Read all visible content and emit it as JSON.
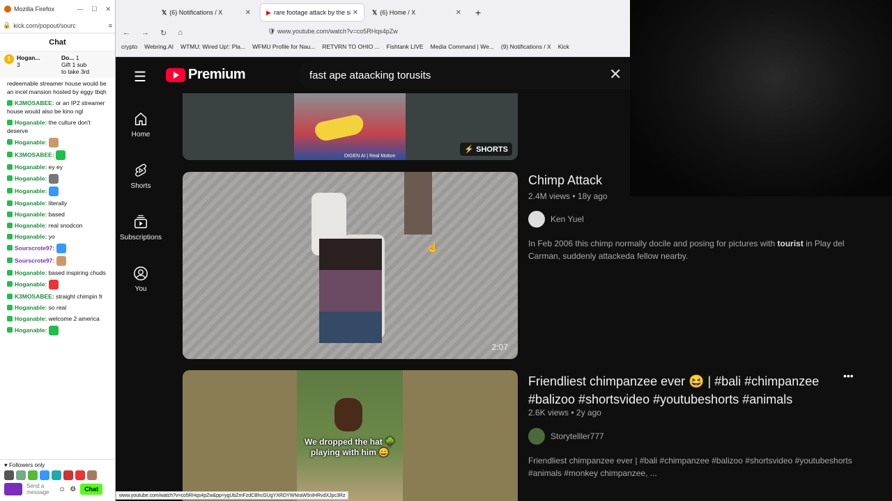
{
  "chat_popout": {
    "window_title": "Mozilla Firefox",
    "url": "kick.com/popout/sourc",
    "header": "Chat",
    "pinned": [
      {
        "badge": "1",
        "name": "Hogan...",
        "count": "3"
      },
      {
        "name": "Do...",
        "count": "1",
        "line1": "Gift 1 sub",
        "line2": "to take 3rd"
      }
    ],
    "messages": [
      {
        "user": "",
        "text": "redeemable streamer house would be an incel mansion hosted by eggy tbqh"
      },
      {
        "user": "K3MOSABEE:",
        "text": "or an IP2 streamer house would also be kino ngl"
      },
      {
        "user": "Hoganable:",
        "text": "the culture don't deserve"
      },
      {
        "user": "Hoganable:",
        "text": ""
      },
      {
        "user": "K3MOSABEE:",
        "text": ""
      },
      {
        "user": "Hoganable:",
        "text": "ey ey"
      },
      {
        "user": "Hoganable:",
        "text": ""
      },
      {
        "user": "Hoganable:",
        "text": ""
      },
      {
        "user": "Hoganable:",
        "text": "literally"
      },
      {
        "user": "Hoganable:",
        "text": "based"
      },
      {
        "user": "Hoganable:",
        "text": "real snodcon"
      },
      {
        "user": "Hoganable:",
        "text": "yo"
      },
      {
        "user": "Sourscrote97:",
        "text": ""
      },
      {
        "user": "Sourscrote97:",
        "text": ""
      },
      {
        "user": "Hoganable:",
        "text": "based inspiring chuds"
      },
      {
        "user": "Hoganable:",
        "text": ""
      },
      {
        "user": "K3MOSABEE:",
        "text": "straight chimpin fr"
      },
      {
        "user": "Hoganable:",
        "text": "so real"
      },
      {
        "user": "Hoganable:",
        "text": "welcome 2 america"
      },
      {
        "user": "Hoganable:",
        "text": ""
      }
    ],
    "followers_only": "Followers only",
    "send_placeholder": "Send a message",
    "chat_button": "Chat"
  },
  "browser": {
    "tabs": [
      "(6) Notifications / X",
      "rare footage attack by the silve",
      "(6) Home / X"
    ],
    "url": "www.youtube.com/watch?v=co5RHqs4pZw",
    "bookmarks": [
      "crypto",
      "Webring.AI",
      "WTMU: Wired Up!: Pla...",
      "WFMU Profile for Nau...",
      "RETVRN TO OHIO ...",
      "Fishtank LIVE",
      "Media Command | We...",
      "(9) Notifications / X",
      "Kick"
    ]
  },
  "youtube": {
    "logo": "Premium",
    "search_value": "fast ape ataacking torusits",
    "sidebar": [
      "Home",
      "Shorts",
      "Subscriptions",
      "You"
    ],
    "shorts_badge": "SHORTS",
    "results": [
      {
        "title": "Chimp Attack",
        "views": "2.4M",
        "age": "18y ago",
        "channel": "Ken Yuel",
        "duration": "2:07",
        "description_pre": "In Feb 2006 this chimp normally docile and posing for pictures with ",
        "description_bold": "tourist",
        "description_post": " in Play del Carman, suddenly attackeda fellow nearby."
      },
      {
        "title": "Friendliest chimpanzee ever 😆 | #bali #chimpanzee #balizoo #shortsvideo #youtubeshorts #animals",
        "views": "2.6K",
        "age": "2y ago",
        "channel": "Storytelller777",
        "caption": "We dropped the hat 🌳 playing with him 😄",
        "description": "Friendliest chimpanzee ever | #bali #chimpanzee #balizoo #shortsvideo #youtubeshorts #animals #monkey chimpanzee, ..."
      }
    ],
    "thumb_text": "DIGEN AI | Real Motion"
  },
  "status_url": "www.youtube.com/watch?v=co5RHqs4pZw&pp=ygUbZmFzdCBhcGUgYXRDYWNraW5nIHRvdXJpc3Rz"
}
